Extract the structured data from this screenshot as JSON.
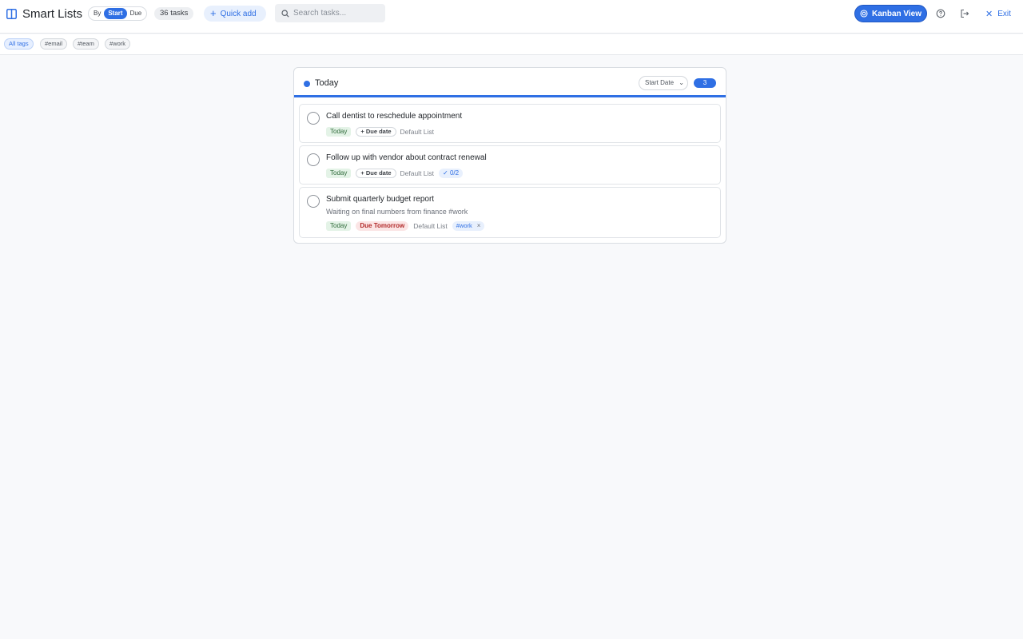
{
  "header": {
    "title": "Smart Lists",
    "view_mode": {
      "label": "By",
      "options": [
        "Start",
        "Due"
      ],
      "selected": "Start"
    },
    "task_count": "36 tasks",
    "quick_add_label": "Quick add",
    "search_placeholder": "Search tasks...",
    "kanban_label": "Kanban View",
    "exit_label": "Exit"
  },
  "tags": {
    "all_label": "All tags",
    "items": [
      "#email",
      "#team",
      "#work"
    ]
  },
  "column": {
    "title": "Today",
    "sort_label": "Start Date",
    "count": "3",
    "accent": "#2f6fe4"
  },
  "tasks": [
    {
      "title": "Call dentist to reschedule appointment",
      "start": "Today",
      "due": "+ Due date",
      "list": "Default List"
    },
    {
      "title": "Follow up with vendor about contract renewal",
      "start": "Today",
      "due": "+ Due date",
      "list": "Default List",
      "subtasks": "0/2"
    },
    {
      "title": "Submit quarterly budget report",
      "note": "Waiting on final numbers from finance #work",
      "start": "Today",
      "due": "Due Tomorrow",
      "list": "Default List",
      "tag": "#work"
    }
  ]
}
